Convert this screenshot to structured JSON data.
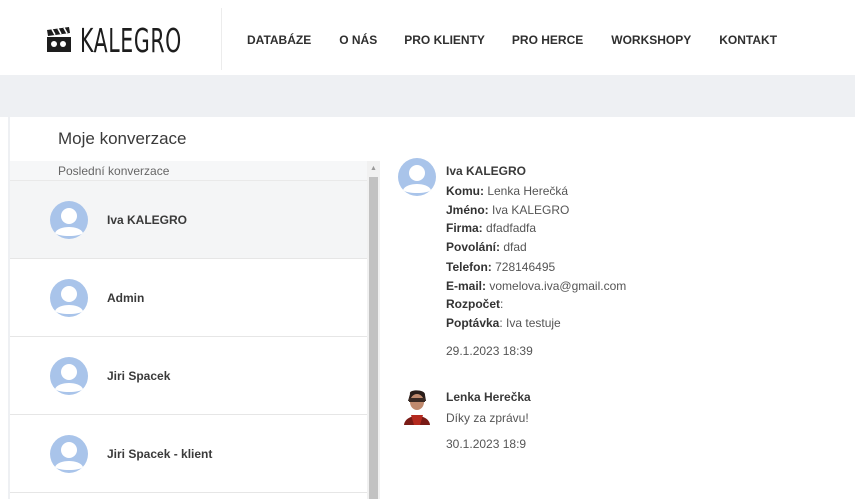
{
  "header": {
    "logo_text": "KALEGRO",
    "logo_icon": "clapperboard-icon",
    "nav": [
      "DATABÁZE",
      "O NÁS",
      "PRO KLIENTY",
      "PRO HERCE",
      "WORKSHOPY",
      "KONTAKT"
    ]
  },
  "sidebar": {
    "title": "Moje konverzace",
    "subtitle": "Poslední konverzace",
    "conversations": [
      {
        "name": "Iva KALEGRO",
        "active": true
      },
      {
        "name": "Admin"
      },
      {
        "name": "Jiri Spacek"
      },
      {
        "name": "Jiri Spacek - klient"
      }
    ]
  },
  "messages": [
    {
      "sender": "Iva KALEGRO",
      "fields": [
        {
          "label": "Komu:",
          "value": " Lenka Herečká"
        },
        {
          "label": "Jméno:",
          "value": " Iva KALEGRO"
        },
        {
          "label": "Firma:",
          "value": " dfadfadfa"
        },
        {
          "label": "Povolání:",
          "value": " dfad"
        },
        {
          "label": "Telefon:",
          "value": " 728146495"
        },
        {
          "label": "E-mail:",
          "value": " vomelova.iva@gmail.com"
        },
        {
          "label": "Rozpočet",
          "value": ":"
        },
        {
          "label": "Poptávka",
          "value": ": Iva testuje"
        }
      ],
      "timestamp": "29.1.2023 18:39"
    },
    {
      "sender": "Lenka Herečka",
      "text": "Díky za zprávu!",
      "timestamp": "30.1.2023 18:9"
    }
  ],
  "colors": {
    "avatar_fill": "#a9c4ea",
    "band": "#eef0f3"
  }
}
